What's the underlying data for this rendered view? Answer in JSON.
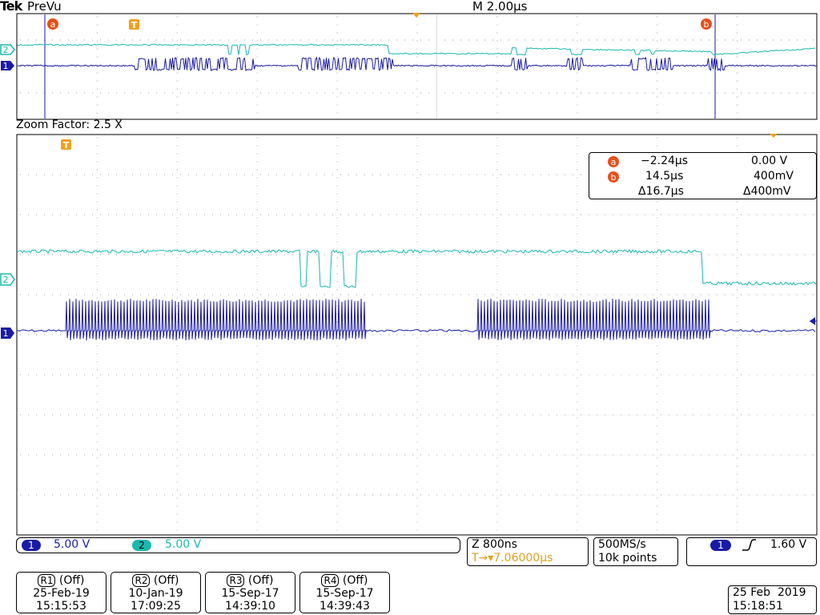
{
  "header": {
    "brand": "Tek",
    "mode": "PreVu",
    "timebase": "M 2.00µs"
  },
  "zoom": {
    "label": "Zoom Factor: 2.5 X"
  },
  "markers": {
    "cursor_a": "a",
    "cursor_b": "b",
    "trigger": "T",
    "ch1": "1",
    "ch2": "2"
  },
  "cursor_readout": {
    "a_time": "−2.24µs",
    "a_volt": "0.00 V",
    "b_time": "14.5µs",
    "b_volt": "400mV",
    "delta_time": "Δ16.7µs",
    "delta_volt": "Δ400mV"
  },
  "channel_bar": {
    "ch1_label": "1",
    "ch1_scale": "5.00 V",
    "ch2_label": "2",
    "ch2_scale": "5.00 V"
  },
  "zoom_info": {
    "zoom_scale": "Z 800ns",
    "trigger_pos": "T→▾7.06000µs"
  },
  "acquisition": {
    "rate": "500MS/s",
    "points": "10k points"
  },
  "trigger_info": {
    "source": "1",
    "slope_icon": "rising-edge",
    "level": "1.60 V"
  },
  "references": [
    {
      "name": "R1",
      "state": "(Off)",
      "date": "25-Feb-19",
      "time": "15:15:53"
    },
    {
      "name": "R2",
      "state": "(Off)",
      "date": "10-Jan-19",
      "time": "17:09:25"
    },
    {
      "name": "R3",
      "state": "(Off)",
      "date": "15-Sep-17",
      "time": "14:39:10"
    },
    {
      "name": "R4",
      "state": "(Off)",
      "date": "15-Sep-17",
      "time": "14:39:43"
    }
  ],
  "clock": {
    "date": "25 Feb  2019",
    "time": "15:18:51"
  },
  "colors": {
    "ch1": "#1a1aa8",
    "ch2": "#1ab8b0",
    "cursor": "#e8501a",
    "trigger": "#f0a020",
    "grid": "#9a9a9a"
  }
}
